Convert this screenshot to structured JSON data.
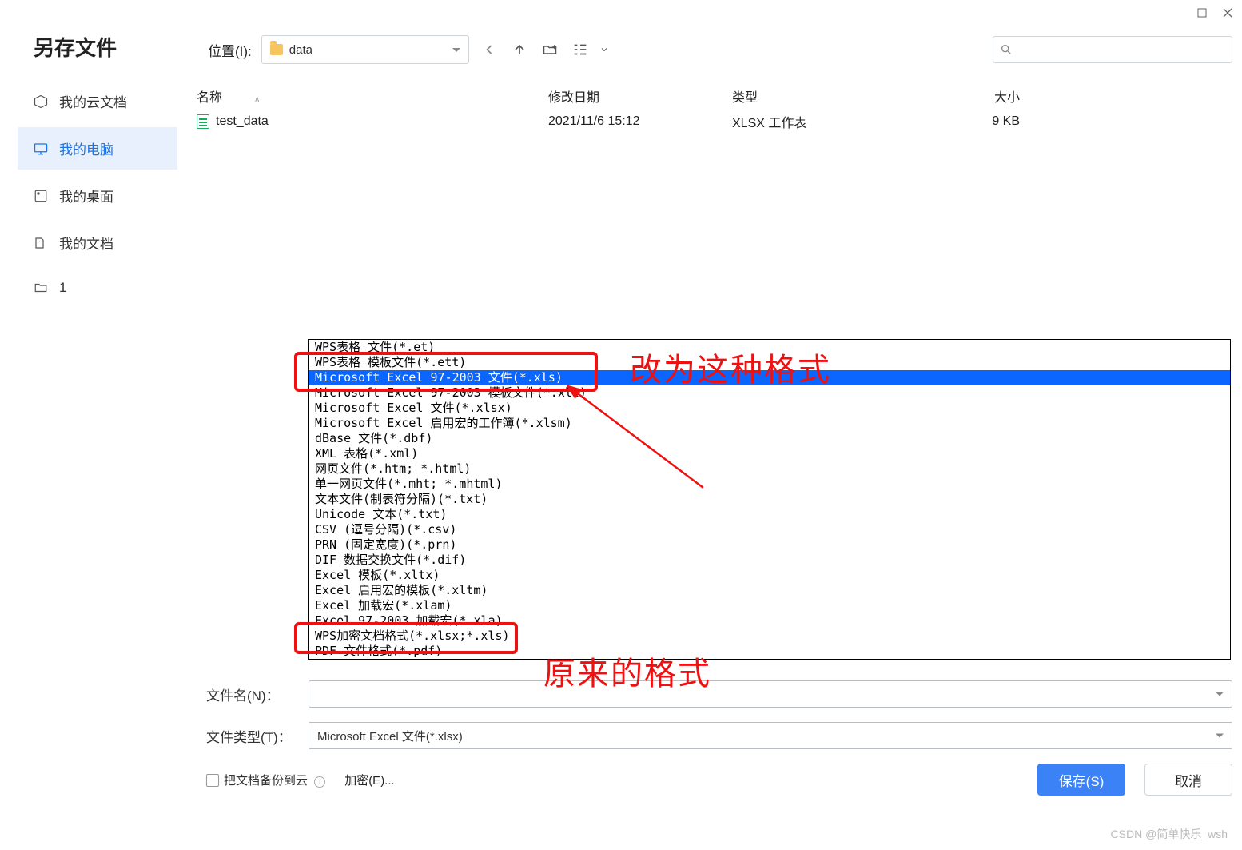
{
  "title": "另存文件",
  "sidebar": {
    "items": [
      {
        "label": "我的云文档",
        "icon": "cloud-doc-icon"
      },
      {
        "label": "我的电脑",
        "icon": "my-computer-icon"
      },
      {
        "label": "我的桌面",
        "icon": "desktop-icon"
      },
      {
        "label": "我的文档",
        "icon": "documents-icon"
      },
      {
        "label": "1",
        "icon": "folder-icon"
      }
    ],
    "active_index": 1
  },
  "location": {
    "label": "位置(I):",
    "value": "data"
  },
  "search": {
    "placeholder": ""
  },
  "columns": {
    "name": "名称",
    "modified": "修改日期",
    "type": "类型",
    "size": "大小"
  },
  "files": [
    {
      "name": "test_data",
      "modified": "2021/11/6 15:12",
      "type": "XLSX 工作表",
      "size": "9 KB"
    }
  ],
  "filename": {
    "label": "文件名(N)：",
    "value": ""
  },
  "filetype": {
    "label": "文件类型(T)：",
    "value": "Microsoft Excel 文件(*.xlsx)"
  },
  "filetype_options": [
    "WPS表格 文件(*.et)",
    "WPS表格 模板文件(*.ett)",
    "Microsoft Excel 97-2003 文件(*.xls)",
    "Microsoft Excel 97-2003 模板文件(*.xlt)",
    "Microsoft Excel 文件(*.xlsx)",
    "Microsoft Excel 启用宏的工作簿(*.xlsm)",
    "dBase 文件(*.dbf)",
    "XML 表格(*.xml)",
    "网页文件(*.htm; *.html)",
    "单一网页文件(*.mht; *.mhtml)",
    "文本文件(制表符分隔)(*.txt)",
    "Unicode 文本(*.txt)",
    "CSV (逗号分隔)(*.csv)",
    "PRN (固定宽度)(*.prn)",
    "DIF 数据交换文件(*.dif)",
    "Excel 模板(*.xltx)",
    "Excel 启用宏的模板(*.xltm)",
    "Excel 加载宏(*.xlam)",
    "Excel 97-2003 加载宏(*.xla)",
    "WPS加密文档格式(*.xlsx;*.xls)",
    "PDF 文件格式(*.pdf)"
  ],
  "filetype_selected_index": 2,
  "backup_label": "把文档备份到云",
  "encrypt_label": "加密(E)...",
  "save_label": "保存(S)",
  "cancel_label": "取消",
  "annotations": {
    "change_to": "改为这种格式",
    "original": "原来的格式"
  },
  "watermark": "CSDN @简单快乐_wsh"
}
